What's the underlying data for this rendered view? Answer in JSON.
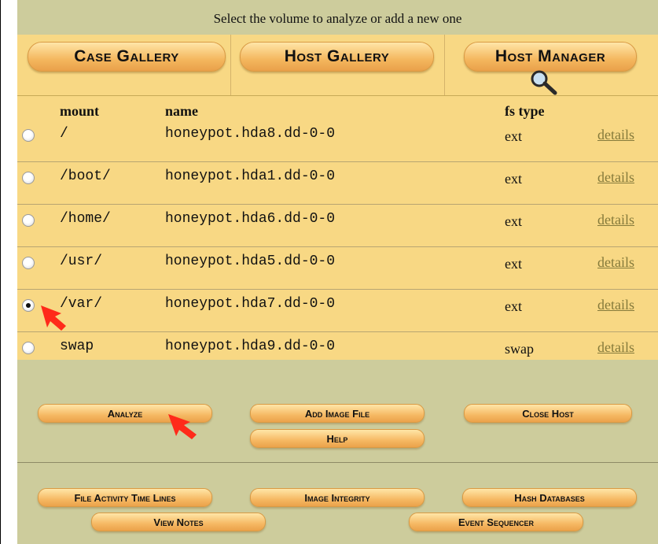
{
  "header": {
    "title": "Select the volume to analyze or add a new one"
  },
  "gallery": {
    "case_gallery": "Case Gallery",
    "host_gallery": "Host Gallery",
    "host_manager": "Host Manager",
    "icon": "magnifier-icon"
  },
  "table": {
    "columns": {
      "mount": "mount",
      "name": "name",
      "fs_type": "fs type"
    },
    "rows": [
      {
        "mount": "/",
        "name": "honeypot.hda8.dd-0-0",
        "fs": "ext",
        "details": "details",
        "selected": false
      },
      {
        "mount": "/boot/",
        "name": "honeypot.hda1.dd-0-0",
        "fs": "ext",
        "details": "details",
        "selected": false
      },
      {
        "mount": "/home/",
        "name": "honeypot.hda6.dd-0-0",
        "fs": "ext",
        "details": "details",
        "selected": false
      },
      {
        "mount": "/usr/",
        "name": "honeypot.hda5.dd-0-0",
        "fs": "ext",
        "details": "details",
        "selected": false
      },
      {
        "mount": "/var/",
        "name": "honeypot.hda7.dd-0-0",
        "fs": "ext",
        "details": "details",
        "selected": true
      },
      {
        "mount": "swap",
        "name": "honeypot.hda9.dd-0-0",
        "fs": "swap",
        "details": "details",
        "selected": false
      }
    ]
  },
  "actions": {
    "analyze": "Analyze",
    "add_image": "Add Image File",
    "close_host": "Close Host",
    "help": "Help"
  },
  "footer": {
    "file_activity": "File Activity Time Lines",
    "image_integrity": "Image Integrity",
    "hash_databases": "Hash Databases",
    "view_notes": "View Notes",
    "event_sequencer": "Event Sequencer"
  },
  "colors": {
    "panel": "#cdcc9c",
    "table_bg": "#f8d884",
    "button": "#f4b75e",
    "link": "#857a3b",
    "arrow": "#ff2a1a"
  }
}
